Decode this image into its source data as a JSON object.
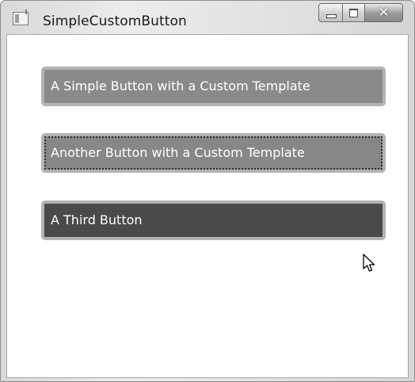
{
  "window": {
    "title": "SimpleCustomButton",
    "icon": "app-window-icon",
    "caption_buttons": [
      "minimize",
      "maximize",
      "close"
    ],
    "close_glyph": "✕"
  },
  "buttons": [
    {
      "label": "A Simple Button with a Custom Template",
      "state": "normal",
      "color": "#8a8a8a"
    },
    {
      "label": "Another Button with a Custom Template",
      "state": "focused",
      "color": "#878787"
    },
    {
      "label": "A Third Button",
      "state": "hover",
      "color": "#4a4a4a"
    }
  ],
  "cursor": {
    "icon": "arrow-pointer-icon"
  }
}
